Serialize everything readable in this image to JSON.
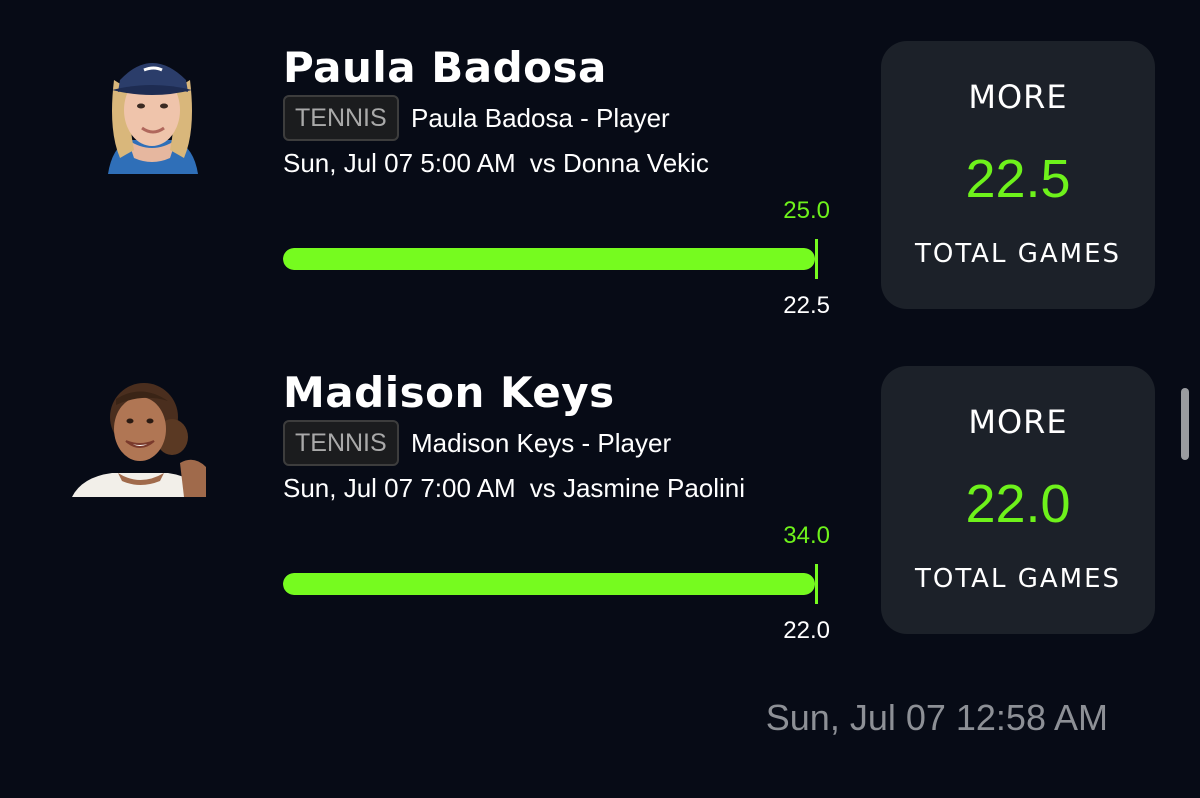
{
  "picks": [
    {
      "player_name": "Paula Badosa",
      "sport": "TENNIS",
      "subtitle": "Paula Badosa - Player",
      "date_time": "Sun, Jul 07 5:00 AM",
      "opponent": "vs Donna Vekic",
      "bar_top_value": "25.0",
      "bar_bottom_value": "22.5",
      "bar_fill_fraction": 1.0,
      "direction": "MORE",
      "line": "22.5",
      "stat": "TOTAL GAMES",
      "avatar_icon": "player-photo-icon"
    },
    {
      "player_name": "Madison Keys",
      "sport": "TENNIS",
      "subtitle": "Madison Keys - Player",
      "date_time": "Sun, Jul 07 7:00 AM",
      "opponent": "vs Jasmine Paolini",
      "bar_top_value": "34.0",
      "bar_bottom_value": "22.0",
      "bar_fill_fraction": 1.0,
      "direction": "MORE",
      "line": "22.0",
      "stat": "TOTAL GAMES",
      "avatar_icon": "player-photo-icon"
    }
  ],
  "footer": {
    "timestamp": "Sun, Jul 07 12:58 AM"
  },
  "colors": {
    "background": "#070b16",
    "accent_green": "#76fb1f",
    "card": "#1c2129",
    "muted_text": "#8d9096"
  }
}
